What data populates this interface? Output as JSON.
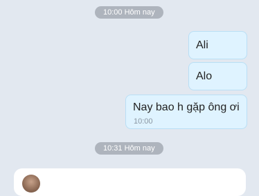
{
  "conversation": {
    "separators": [
      {
        "label": "10:00 Hôm nay"
      },
      {
        "label": "10:31 Hôm nay"
      }
    ],
    "messages": [
      {
        "text": "Ali",
        "time": ""
      },
      {
        "text": "Alo",
        "time": ""
      },
      {
        "text": "Nay bao h gặp ông ơi",
        "time": "10:00"
      }
    ]
  },
  "colors": {
    "background": "#e2e8f0",
    "outgoing_bubble": "#dff3ff",
    "time_pill": "#aeb4bd",
    "incoming_card": "#ffffff"
  }
}
